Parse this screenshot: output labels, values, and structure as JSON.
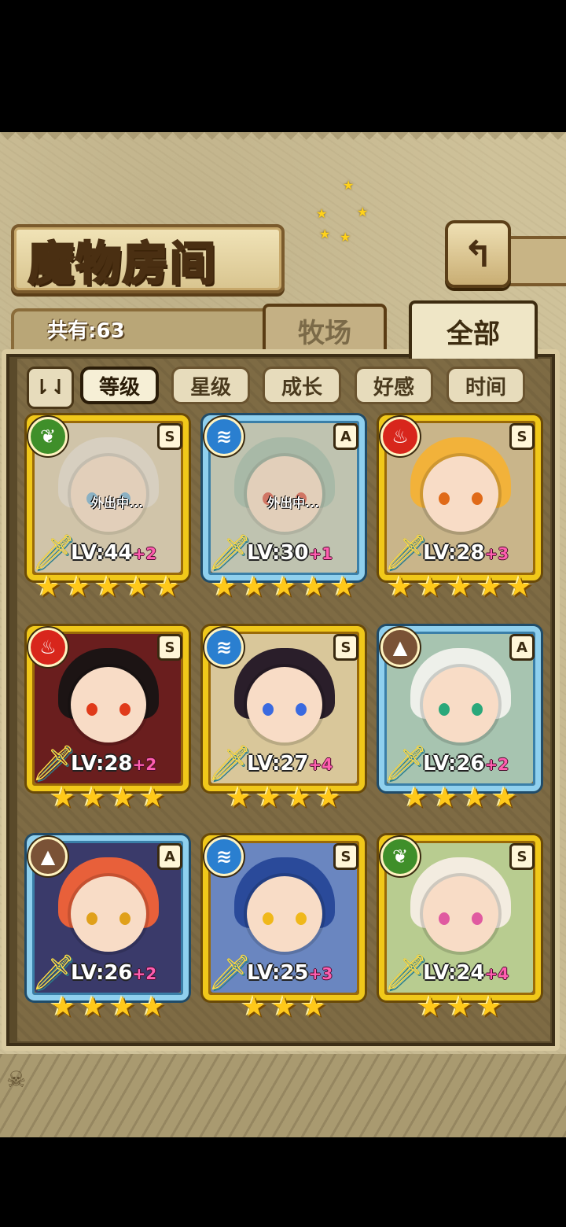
{
  "title": "魔物房间",
  "back_button": {
    "icon": "return-arrow-icon",
    "label": "↰"
  },
  "count": {
    "text": "共有:63"
  },
  "tabs": [
    {
      "label": "牧场",
      "active": false
    },
    {
      "label": "全部",
      "active": true
    }
  ],
  "sort": {
    "toggle_label": "⇂⇃",
    "options": [
      {
        "label": "等级",
        "active": true
      },
      {
        "label": "星级",
        "active": false
      },
      {
        "label": "成长",
        "active": false
      },
      {
        "label": "好感",
        "active": false
      },
      {
        "label": "时间",
        "active": false
      }
    ]
  },
  "elements": {
    "nature": {
      "icon": "leaf-icon",
      "glyph": "❦",
      "color": "#3f8f2a"
    },
    "water": {
      "icon": "water-icon",
      "glyph": "≋",
      "color": "#2a7fd0"
    },
    "fire": {
      "icon": "flame-icon",
      "glyph": "♨",
      "color": "#d8261c"
    },
    "earth": {
      "icon": "mountain-icon",
      "glyph": "▲",
      "color": "#7a5236"
    }
  },
  "monsters": [
    {
      "element": "nature",
      "rank": "S",
      "level": "LV:44",
      "bonus": "+2",
      "stars": 5,
      "status": "外出中...",
      "hair": "#e4ddd2",
      "eye": "#5aa7d8",
      "bg": "#d7c9a8"
    },
    {
      "element": "water",
      "rank": "A",
      "level": "LV:30",
      "bonus": "+1",
      "stars": 5,
      "status": "外出中...",
      "hair": "#8fb5a4",
      "eye": "#d83a2a",
      "bg": "#b9c6b4"
    },
    {
      "element": "fire",
      "rank": "S",
      "level": "LV:28",
      "bonus": "+3",
      "stars": 5,
      "status": "",
      "hair": "#f2b23a",
      "eye": "#e06a18",
      "bg": "#c9b58a"
    },
    {
      "element": "fire",
      "rank": "S",
      "level": "LV:28",
      "bonus": "+2",
      "stars": 4,
      "status": "",
      "hair": "#1c1414",
      "eye": "#e03a1a",
      "bg": "#6a1e1e"
    },
    {
      "element": "water",
      "rank": "S",
      "level": "LV:27",
      "bonus": "+4",
      "stars": 4,
      "status": "",
      "hair": "#2a1e2a",
      "eye": "#3a6ae0",
      "bg": "#d9c79a"
    },
    {
      "element": "earth",
      "rank": "A",
      "level": "LV:26",
      "bonus": "+2",
      "stars": 4,
      "status": "",
      "hair": "#eef0ea",
      "eye": "#2aa87a",
      "bg": "#a7c4b0"
    },
    {
      "element": "earth",
      "rank": "A",
      "level": "LV:26",
      "bonus": "+2",
      "stars": 4,
      "status": "",
      "hair": "#e8603a",
      "eye": "#e0a01a",
      "bg": "#3a3a6a"
    },
    {
      "element": "water",
      "rank": "S",
      "level": "LV:25",
      "bonus": "+3",
      "stars": 3,
      "status": "",
      "hair": "#2a4a9a",
      "eye": "#f0b81a",
      "bg": "#6a86c0"
    },
    {
      "element": "nature",
      "rank": "S",
      "level": "LV:24",
      "bonus": "+4",
      "stars": 3,
      "status": "",
      "hair": "#f3ece0",
      "eye": "#e05aa0",
      "bg": "#b8cc90"
    }
  ]
}
